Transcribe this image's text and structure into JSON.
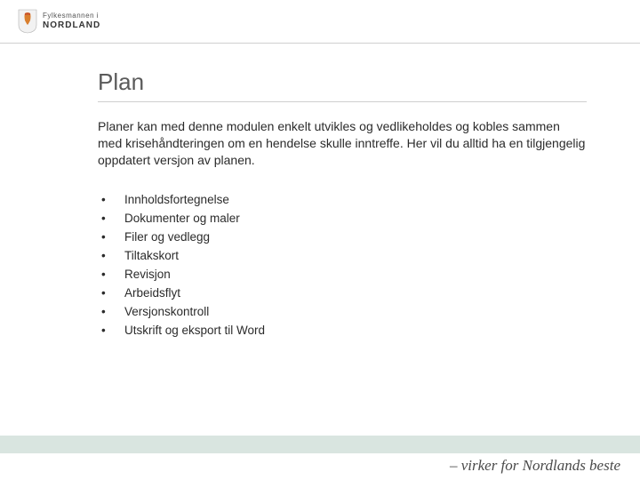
{
  "header": {
    "logo_line1": "Fylkesmannen i",
    "logo_line2": "NORDLAND"
  },
  "page": {
    "title": "Plan",
    "body": "Planer kan med denne modulen enkelt utvikles og vedlikeholdes og kobles sammen med krisehåndteringen om en hendelse skulle inntreffe. Her vil du alltid ha en tilgjengelig oppdatert versjon av planen.",
    "bullets": [
      "Innholdsfortegnelse",
      "Dokumenter og maler",
      "Filer og vedlegg",
      "Tiltakskort",
      "Revisjon",
      "Arbeidsflyt",
      "Versjonskontroll",
      "Utskrift og eksport til Word"
    ]
  },
  "footer": {
    "tagline": "– virker for Nordlands beste"
  }
}
